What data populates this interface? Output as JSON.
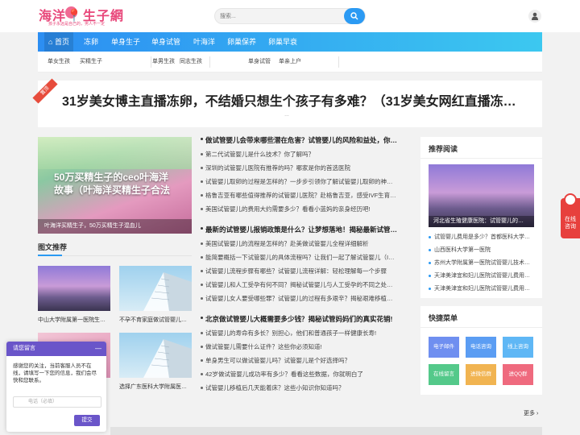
{
  "header": {
    "logo_text": "海洋📍生子網",
    "logo_slogan": "孩子永远是自己的，男人不一定",
    "search_placeholder": "搜索..."
  },
  "nav": {
    "items": [
      "首页",
      "冻卵",
      "单身生子",
      "单身试管",
      "叶海洋",
      "卵巢保养",
      "卵巢早衰"
    ]
  },
  "subnav": {
    "items": [
      "单女生孩",
      "买精生子",
      "单男生孩",
      "同志生孩",
      "单身试管",
      "单亲上户"
    ]
  },
  "banner": {
    "tag": "置顶",
    "title": "31岁美女博主直播冻卵，不结婚只想生个孩子有多难？（31岁美女网红直播冻…",
    "dots": "…"
  },
  "slide": {
    "overlay_text": "50万买精生子的ceo叶海洋故事（叶海洋买精生子合法",
    "caption": "叶海洋买精生子，50万买精生子混血儿"
  },
  "picks": {
    "title": "图文推荐",
    "cards": [
      {
        "caption": "中山大学附属第一医院生…"
      },
      {
        "caption": "不孕不育家庭做试管婴儿…"
      },
      {
        "caption": ""
      },
      {
        "caption": "选择广东医科大学附属医…"
      }
    ]
  },
  "lists": [
    {
      "heading": "做试管婴儿会带来哪些潜在危害？试管婴儿的风险和益处，你…",
      "items": [
        "第二代试管婴儿是什么技术？你了解吗？",
        "深圳的试管婴儿医院有推荐的吗？哪家是你的首选医院",
        "试管婴儿取卵的过程是怎样的？一步步引领你了解试管婴儿取卵的神…",
        "格鲁吉亚有哪些值得推荐的试管婴儿医院？赴格鲁吉亚，感受IVF生育…",
        "美国试管婴儿的费用大约需要多少？看看小蓝妈的亲身经历吧!"
      ]
    },
    {
      "heading": "最新的试管婴儿报销政策是什么？让梦想落地！揭秘最新试管…",
      "items": [
        "美国试管婴儿的流程是怎样的？赴美做试管婴儿全程详细解析",
        "能简要概括一下试管婴儿的具体流程吗？让我们一起了解试管婴儿（I…",
        "试管婴儿流程步骤有哪些？试管婴儿流程详解：轻松理解每一个步骤",
        "试管婴儿和人工受孕有何不同？揭秘试管婴儿与人工受孕的不同之处…",
        "试管婴儿女人要受哪些罪？试管婴儿的过程有多艰辛？揭秘艰难移植…"
      ]
    },
    {
      "heading": "北京做试管婴儿大概需要多少钱？揭秘试管妈妈们的真实花销!",
      "items": [
        "试管婴儿的寿命有多长？别担心，他们和普通孩子一样健康长寿!",
        "做试管婴儿需要什么证件？这些你必须知道!",
        "单身男生可以做试管婴儿吗？试管婴儿是个好选择吗？",
        "42岁做试管婴儿成功率有多少？看看这些数据，你就明白了",
        "试管婴儿移植后几天能着床？这些小知识你知道吗？"
      ]
    }
  ],
  "sidebar": {
    "recommend_title": "推荐阅读",
    "recommend_img_caption": "河北省生殖健康医院：试管婴儿的…",
    "recommend_items": [
      "试管婴儿费用是多少？首都医科大学…",
      "山西医科大学第一医院",
      "苏州大学附属第一医院试管婴儿技术…",
      "天津美津宜和妇儿医院试管婴儿费用…",
      "天津美津宜和妇儿医院试管婴儿费用…"
    ],
    "menu_title": "快捷菜单",
    "menu_buttons": [
      {
        "label": "电子邮件",
        "color": "#6f8ff0"
      },
      {
        "label": "电话咨询",
        "color": "#5b9df3"
      },
      {
        "label": "线上咨询",
        "color": "#5fb7f5"
      },
      {
        "label": "在线留言",
        "color": "#54c98a"
      },
      {
        "label": "进微信群",
        "color": "#f1b451"
      },
      {
        "label": "进QQ群",
        "color": "#ef6a7e"
      }
    ]
  },
  "more_label": "更多 ›",
  "float_consult": "在线咨询",
  "chat": {
    "title": "请您留言",
    "minimize": "—",
    "message": "感谢您的关注，当前客服人员不在线，请填写一下您的信息，我们会尽快和您联系。",
    "phone_placeholder": "电话（必填）",
    "submit": "提交"
  },
  "colors": {
    "brand_pink": "#e8477a",
    "nav_blue": "#2c8ef2",
    "chat_purple": "#6a55c9",
    "consult_red": "#e7403d"
  }
}
